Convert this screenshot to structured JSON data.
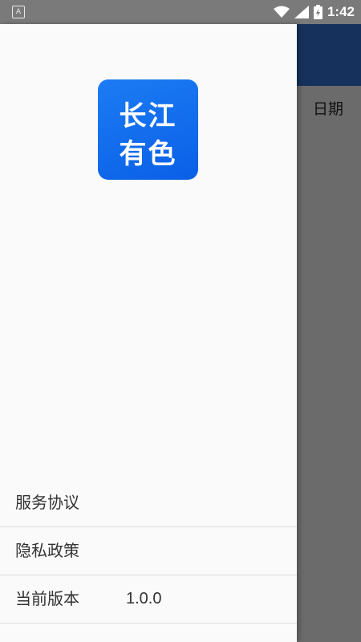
{
  "status_bar": {
    "time": "1:42",
    "notification_icon": "a-notification-icon",
    "icons": [
      "wifi-icon",
      "signal-icon",
      "battery-charging-icon"
    ]
  },
  "app": {
    "visible_column_partial": "：",
    "visible_column": "日期"
  },
  "drawer": {
    "logo": {
      "line1": "长江",
      "line2": "有色",
      "color": "#0a6cf0"
    },
    "menu": [
      {
        "label": "服务协议"
      },
      {
        "label": "隐私政策"
      },
      {
        "label": "当前版本",
        "value": "1.0.0"
      }
    ]
  }
}
